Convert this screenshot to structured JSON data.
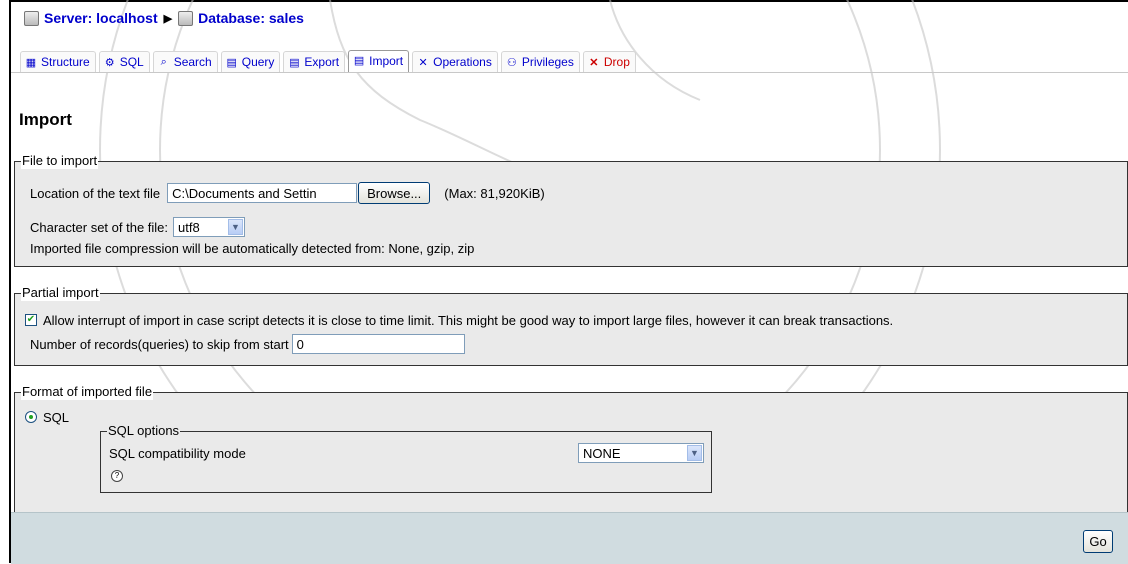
{
  "breadcrumb": {
    "server": "Server: localhost",
    "database": "Database: sales"
  },
  "tabs": [
    {
      "label": "Structure",
      "icon": "structure-icon"
    },
    {
      "label": "SQL",
      "icon": "sql-icon"
    },
    {
      "label": "Search",
      "icon": "search-icon"
    },
    {
      "label": "Query",
      "icon": "query-icon"
    },
    {
      "label": "Export",
      "icon": "export-icon"
    },
    {
      "label": "Import",
      "icon": "import-icon"
    },
    {
      "label": "Operations",
      "icon": "operations-icon"
    },
    {
      "label": "Privileges",
      "icon": "privileges-icon"
    },
    {
      "label": "Drop",
      "icon": "drop-icon"
    }
  ],
  "active_tab": "Import",
  "page_title": "Import",
  "file_to_import": {
    "legend": "File to import",
    "location_label": "Location of the text file",
    "file_value": "C:\\Documents and Settin",
    "browse_label": "Browse...",
    "max_note": "(Max: 81,920KiB)",
    "charset_label": "Character set of the file:",
    "charset_value": "utf8",
    "compression_note": "Imported file compression will be automatically detected from: None, gzip, zip"
  },
  "partial_import": {
    "legend": "Partial import",
    "allow_interrupt_checked": true,
    "allow_interrupt_label": "Allow interrupt of import in case script detects it is close to time limit. This might be good way to import large files, however it can break transactions.",
    "skip_label": "Number of records(queries) to skip from start",
    "skip_value": "0"
  },
  "format": {
    "legend": "Format of imported file",
    "option_label": "SQL",
    "selected": true,
    "sql_options": {
      "legend": "SQL options",
      "compat_label": "SQL compatibility mode",
      "compat_value": "NONE",
      "help_icon": "help-icon"
    }
  },
  "footer": {
    "go_label": "Go"
  },
  "colors": {
    "link": "#0000cc",
    "fieldset_bg": "#eaeaea",
    "footer_bg": "#d0dce0",
    "drop": "#cc0000"
  }
}
